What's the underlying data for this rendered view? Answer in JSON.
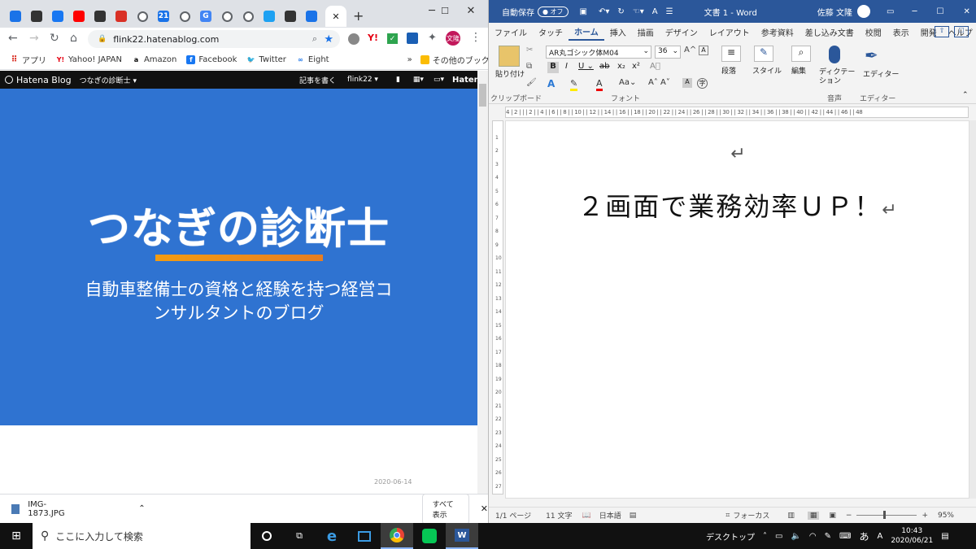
{
  "chrome": {
    "tabs": [
      {
        "icon": "chrome-web-store-icon"
      },
      {
        "icon": "pen-icon"
      },
      {
        "icon": "facebook-icon"
      },
      {
        "icon": "youtube-icon"
      },
      {
        "icon": "note-icon"
      },
      {
        "icon": "gmail-icon"
      },
      {
        "icon": "globe-icon"
      },
      {
        "icon": "calendar-icon",
        "label": "21"
      },
      {
        "icon": "globe-icon"
      },
      {
        "icon": "google-icon",
        "label": "G"
      },
      {
        "icon": "globe-icon"
      },
      {
        "icon": "globe-icon"
      },
      {
        "icon": "twitter-icon"
      },
      {
        "icon": "info-icon"
      },
      {
        "icon": "pr-icon"
      },
      {
        "icon": "close-icon",
        "label": "✕",
        "active": true
      }
    ],
    "new_tab_label": "+",
    "url": "flink22.hatenablog.com",
    "profile_label": "文隆",
    "bookmarks": {
      "apps": "アプリ",
      "yahoo": "Yahoo! JAPAN",
      "amazon": "Amazon",
      "facebook": "Facebook",
      "twitter": "Twitter",
      "eight": "Eight",
      "overflow": "»",
      "other": "その他のブックマーク"
    },
    "hatena_bar": {
      "logo": "Hatena Blog",
      "blog_name": "つなぎの診断士 ▾",
      "write": "記事を書く",
      "user": "flink22 ▾",
      "brand": "Hatena"
    },
    "hero": {
      "title": "つなぎの診断士",
      "subtitle_line1": "自動車整備士の資格と経験を持つ経営コ",
      "subtitle_line2": "ンサルタントのブログ",
      "accent": "#2f73d1"
    },
    "post_date": "2020-06-14",
    "download": {
      "file": "IMG-1873.JPG",
      "show_all": "すべて表示"
    }
  },
  "word": {
    "autosave_label": "自動保存",
    "autosave_state": "オフ",
    "doc_title": "文書 1 - Word",
    "user": "佐藤 文隆",
    "tabs": [
      "ファイル",
      "タッチ",
      "ホーム",
      "挿入",
      "描画",
      "デザイン",
      "レイアウト",
      "参考資料",
      "差し込み文書",
      "校閲",
      "表示",
      "開発",
      "ヘルプ"
    ],
    "active_tab": "ホーム",
    "ribbon": {
      "paste": "貼り付け",
      "font_name": "AR丸ゴシック体M04",
      "font_size": "36",
      "clipboard_group": "クリップボード",
      "font_group": "フォント",
      "paragraph": "段落",
      "styles": "スタイル",
      "editing": "編集",
      "dictation": "ディクテーション",
      "voice_group": "音声",
      "editor": "エディター",
      "editor_group": "エディター"
    },
    "ruler_marks": "4 | 2 | | | 2 | | 4 | | 6 | | 8 | | 10 | | 12 | | 14 | | 16 | | 18 | | 20 | | 22 | | 24 | | 26 | | 28 | | 30 | | 32 | | 34 | | 36 | | 38 | | 40 | | 42 | | 44 | | 46 | | 48",
    "document_text": "２画面で業務効率ＵＰ！",
    "paragraph_mark": "↵",
    "status": {
      "page": "1/1 ページ",
      "words": "11 文字",
      "language": "日本語",
      "focus": "フォーカス",
      "zoom": "95%"
    }
  },
  "taskbar": {
    "search_placeholder": "ここに入力して検索",
    "desktop_label": "デスクトップ",
    "ime": "あ",
    "time": "10:43",
    "date": "2020/06/21"
  }
}
